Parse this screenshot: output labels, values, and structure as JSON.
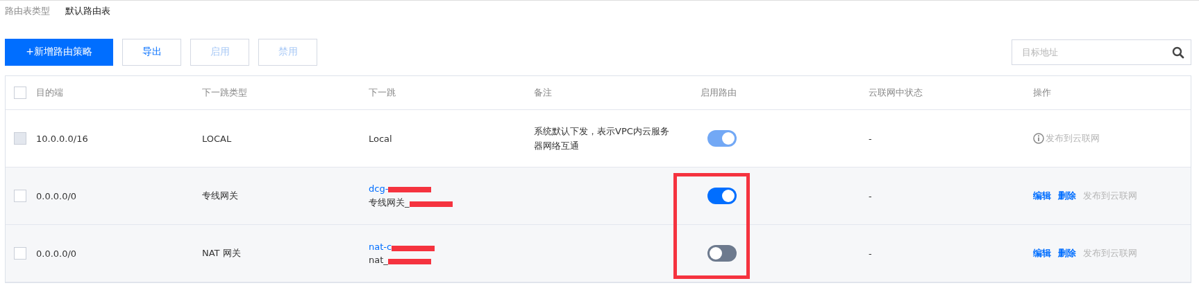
{
  "route_table_type": {
    "label": "路由表类型",
    "value": "默认路由表"
  },
  "toolbar": {
    "buttons": [
      {
        "label": "+新增路由策略",
        "kind": "primary",
        "disabled": false
      },
      {
        "label": "导出",
        "kind": "default",
        "disabled": false
      },
      {
        "label": "启用",
        "kind": "default",
        "disabled": true
      },
      {
        "label": "禁用",
        "kind": "default",
        "disabled": true
      }
    ],
    "search": {
      "placeholder": "目标地址"
    }
  },
  "table": {
    "header_checked": false,
    "columns": [
      "目的端",
      "下一跳类型",
      "下一跳",
      "备注",
      "启用路由",
      "云联网中状态",
      "操作"
    ],
    "rows": [
      {
        "checked": false,
        "disabled": true,
        "destination": "10.0.0.0/16",
        "next_hop_type": "LOCAL",
        "next_hop": {
          "kind": "plain",
          "id": "Local"
        },
        "note": "系统默认下发，表示VPC内云服务器网络互通",
        "route_on": true,
        "toggle_disabled": true,
        "ccn_status": "-",
        "actions": [
          {
            "label": "发布到云联网",
            "kind": "info",
            "disabled": true
          }
        ]
      },
      {
        "checked": false,
        "disabled": false,
        "destination": "0.0.0.0/0",
        "next_hop_type": "专线网关",
        "next_hop": {
          "kind": "redacted",
          "id": "dcg-",
          "name": "专线网关_"
        },
        "route_on": true,
        "toggle_disabled": false,
        "ccn_status": "-",
        "actions": [
          {
            "label": "编辑",
            "kind": "link",
            "disabled": false
          },
          {
            "label": "删除",
            "kind": "link",
            "disabled": false
          },
          {
            "label": "发布到云联网",
            "kind": "link",
            "disabled": true
          }
        ]
      },
      {
        "checked": false,
        "disabled": false,
        "destination": "0.0.0.0/0",
        "next_hop_type": "NAT 网关",
        "next_hop": {
          "kind": "redacted",
          "id": "nat-c",
          "name": "nat_"
        },
        "route_on": false,
        "toggle_disabled": false,
        "ccn_status": "-",
        "actions": [
          {
            "label": "编辑",
            "kind": "link",
            "disabled": false
          },
          {
            "label": "删除",
            "kind": "link",
            "disabled": false
          },
          {
            "label": "发布到云联网",
            "kind": "link",
            "disabled": true
          }
        ]
      }
    ]
  }
}
